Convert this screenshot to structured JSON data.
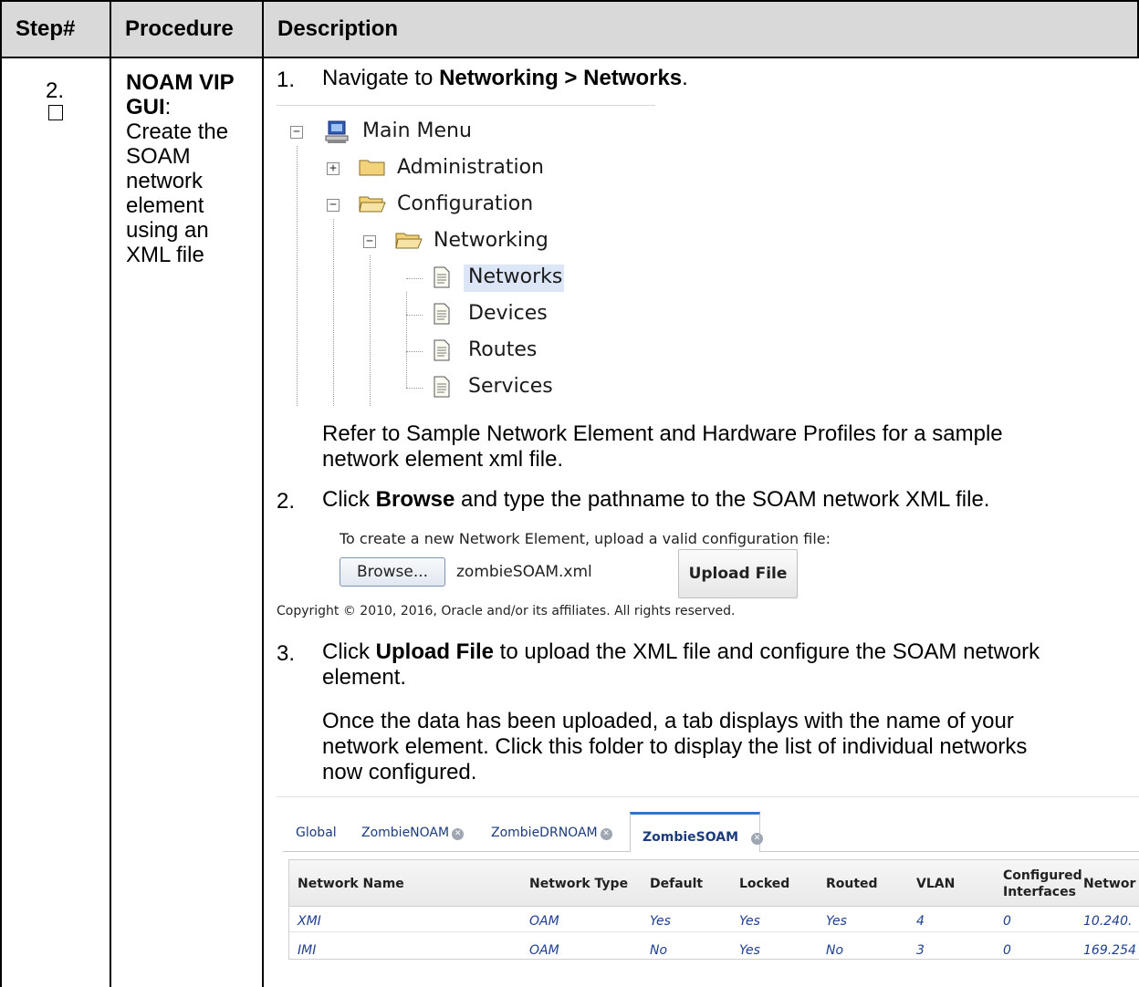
{
  "table": {
    "headers": {
      "step": "Step#",
      "procedure": "Procedure",
      "description": "Description"
    },
    "step_number": "2.",
    "procedure": {
      "bold": "NOAM VIP GUI",
      "rest": ": Create the SOAM network element using an XML file",
      "lines": [
        "NOAM VIP",
        "GUI",
        "Create the",
        "SOAM",
        "network",
        "element",
        "using an",
        "XML file"
      ]
    }
  },
  "steps": {
    "s1": {
      "num": "1.",
      "pre": "Navigate to ",
      "bold": "Networking > Networks",
      "post": "."
    },
    "refer_text": [
      "Refer to Sample Network Element and Hardware Profiles for a sample",
      "network element xml file."
    ],
    "s2": {
      "num": "2.",
      "pre": "Click ",
      "bold": "Browse",
      "post": " and type the pathname to the SOAM network XML file."
    },
    "s3": {
      "num": "3.",
      "pre": "Click ",
      "bold": "Upload File",
      "post": " to upload the XML file and configure the SOAM network",
      "line2": "element."
    },
    "once_text": [
      "Once the data has been uploaded, a tab displays with the name of your",
      "network element.  Click this folder to display the list of individual networks",
      "now configured."
    ]
  },
  "tree": {
    "root": "Main Menu",
    "items": [
      "Administration",
      "Configuration",
      "Networking",
      "Networks",
      "Devices",
      "Routes",
      "Services"
    ]
  },
  "upload": {
    "caption": "To create a new Network Element, upload a valid configuration file:",
    "browse_label": "Browse...",
    "filename": "zombieSOAM.xml",
    "upload_label": "Upload File",
    "copyright": "Copyright © 2010, 2016, Oracle and/or its affiliates. All rights reserved."
  },
  "tabs": [
    "Global",
    "ZombieNOAM",
    "ZombieDRNOAM",
    "ZombieSOAM"
  ],
  "network_table": {
    "columns": [
      "Network Name",
      "Network Type",
      "Default",
      "Locked",
      "Routed",
      "VLAN",
      "Configured",
      "Interfaces",
      "Networ"
    ],
    "rows": [
      [
        "XMI",
        "OAM",
        "Yes",
        "Yes",
        "Yes",
        "4",
        "0",
        "10.240."
      ],
      [
        "IMI",
        "OAM",
        "No",
        "Yes",
        "No",
        "3",
        "0",
        "169.254"
      ]
    ]
  },
  "colors": {
    "header_bg": "#d9d9d9",
    "tab_accent": "#2c78c6",
    "link_text": "#1f3f8f",
    "selected_bg": "#dde6f7"
  },
  "icons": [
    "computer-icon",
    "folder-icon",
    "open-folder-icon",
    "document-icon",
    "expand-toggle-icon",
    "collapse-toggle-icon",
    "tab-close-icon",
    "checkbox-icon"
  ]
}
